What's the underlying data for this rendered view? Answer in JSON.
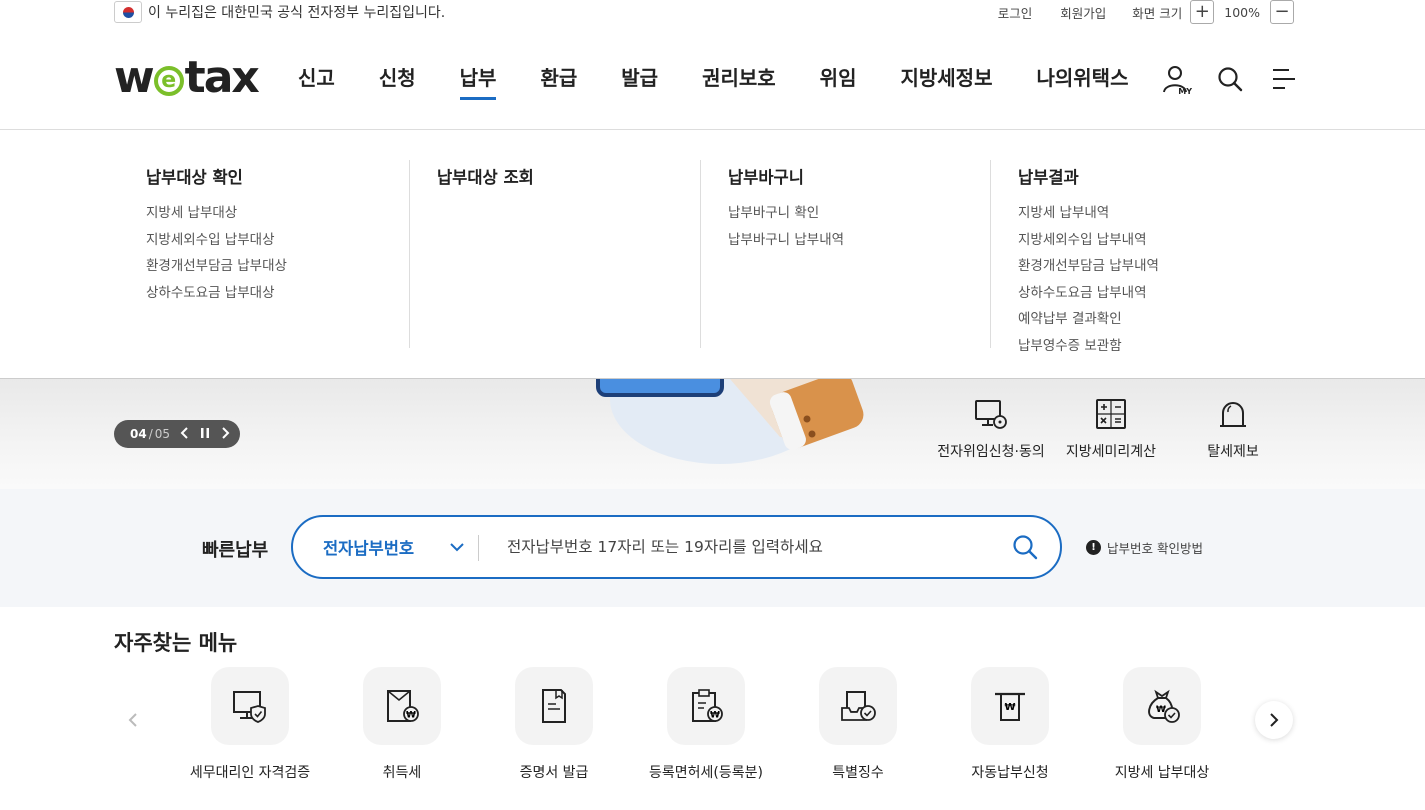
{
  "topbar": {
    "gov_notice": "이 누리집은 대한민국 공식 전자정부 누리집입니다.",
    "login": "로그인",
    "signup": "회원가입",
    "zoom_label": "화면 크기",
    "zoom_in": "+",
    "zoom_value": "100%",
    "zoom_out": "−"
  },
  "header": {
    "logo_w": "w",
    "logo_e": "e",
    "logo_tax": "tax",
    "nav": [
      "신고",
      "신청",
      "납부",
      "환급",
      "발급",
      "권리보호",
      "위임",
      "지방세정보",
      "나의위택스"
    ],
    "active_nav": "납부",
    "my_tag": "MY"
  },
  "mega_menu": {
    "columns": [
      {
        "title": "납부대상 확인",
        "items": [
          "지방세 납부대상",
          "지방세외수입 납부대상",
          "환경개선부담금 납부대상",
          "상하수도요금 납부대상"
        ]
      },
      {
        "title": "납부대상 조회",
        "items": []
      },
      {
        "title": "납부바구니",
        "items": [
          "납부바구니 확인",
          "납부바구니 납부내역"
        ]
      },
      {
        "title": "납부결과",
        "items": [
          "지방세 납부내역",
          "지방세외수입 납부내역",
          "환경개선부담금 납부내역",
          "상하수도요금 납부내역",
          "예약납부 결과확인",
          "납부영수증 보관함"
        ]
      }
    ]
  },
  "hero": {
    "pager_current": "04",
    "pager_sep": "/",
    "pager_total": "05",
    "quick_links": [
      "전자위임신청·동의",
      "지방세미리계산",
      "탈세제보"
    ]
  },
  "fast_pay": {
    "title": "빠른납부",
    "select_value": "전자납부번호",
    "placeholder": "전자납부번호 17자리 또는 19자리를 입력하세요",
    "howto": "납부번호 확인방법"
  },
  "frequent": {
    "title": "자주찾는 메뉴",
    "items": [
      "세무대리인 자격검증",
      "취득세",
      "증명서 발급",
      "등록면허세(등록분)",
      "특별징수",
      "자동납부신청",
      "지방세 납부대상"
    ]
  },
  "colors": {
    "accent": "#1b6cc3",
    "logo_green": "#7bbf2a"
  }
}
